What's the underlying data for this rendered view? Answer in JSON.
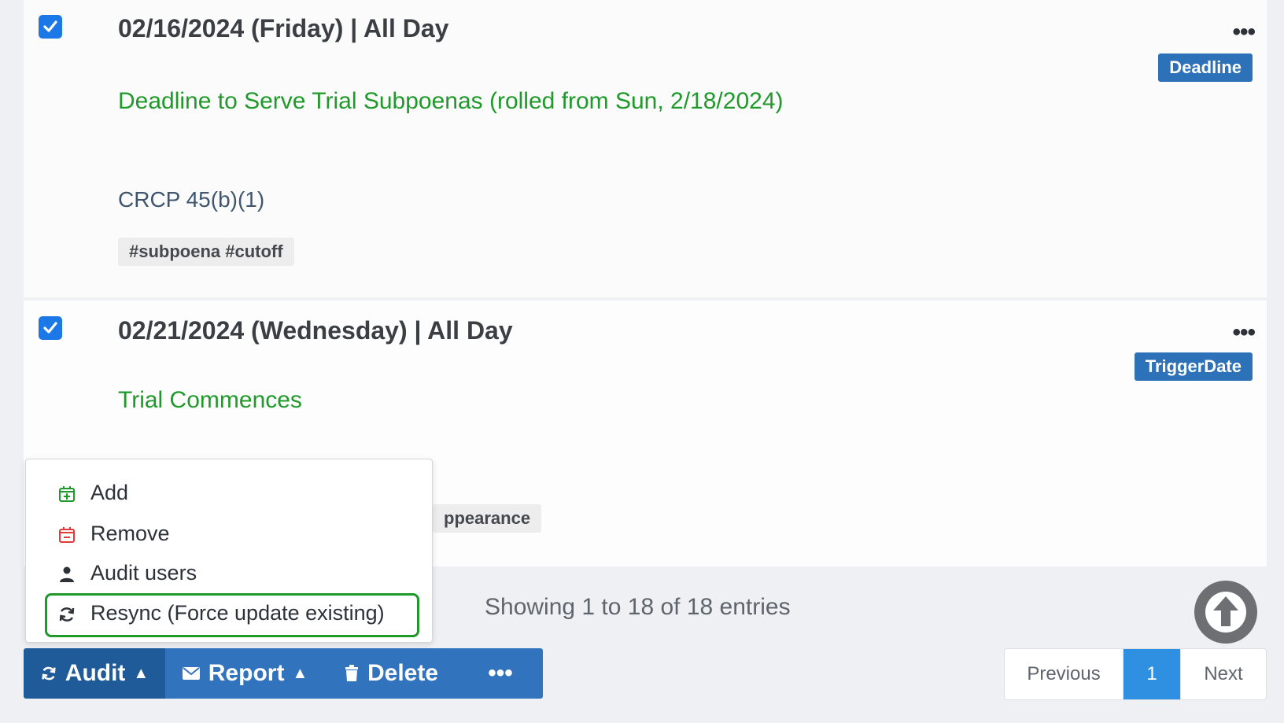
{
  "entries": [
    {
      "date": "02/16/2024 (Friday)  |  All Day",
      "badge": "Deadline",
      "title": "Deadline to Serve Trial Subpoenas (rolled from Sun, 2/18/2024)",
      "rule": "CRCP 45(b)(1)",
      "tags": "#subpoena #cutoff",
      "checked": true
    },
    {
      "date": "02/21/2024 (Wednesday)  |  All Day",
      "badge": "TriggerDate",
      "title": "Trial Commences",
      "tags": "ppearance",
      "checked": true
    }
  ],
  "more_glyph": "•••",
  "dropdown": {
    "items": [
      {
        "label": "Add",
        "icon": "calendar-plus-icon",
        "color": "#1f9a2a"
      },
      {
        "label": "Remove",
        "icon": "calendar-minus-icon",
        "color": "#e03b3b"
      },
      {
        "label": "Audit users",
        "icon": "user-icon",
        "color": "#2d3138"
      },
      {
        "label": "Resync (Force update existing)",
        "icon": "refresh-icon",
        "color": "#2d3138"
      }
    ]
  },
  "footer": {
    "showing": "Showing 1 to 18 of 18 entries"
  },
  "toolbar": {
    "audit_label": "Audit",
    "report_label": "Report",
    "delete_label": "Delete",
    "more_label": "•••"
  },
  "pagination": {
    "previous": "Previous",
    "current_page": "1",
    "next": "Next"
  },
  "colors": {
    "accent": "#3173bd",
    "accent_dark": "#1f5b99",
    "title_green": "#1f9a2a",
    "badge": "#2d72b8"
  }
}
